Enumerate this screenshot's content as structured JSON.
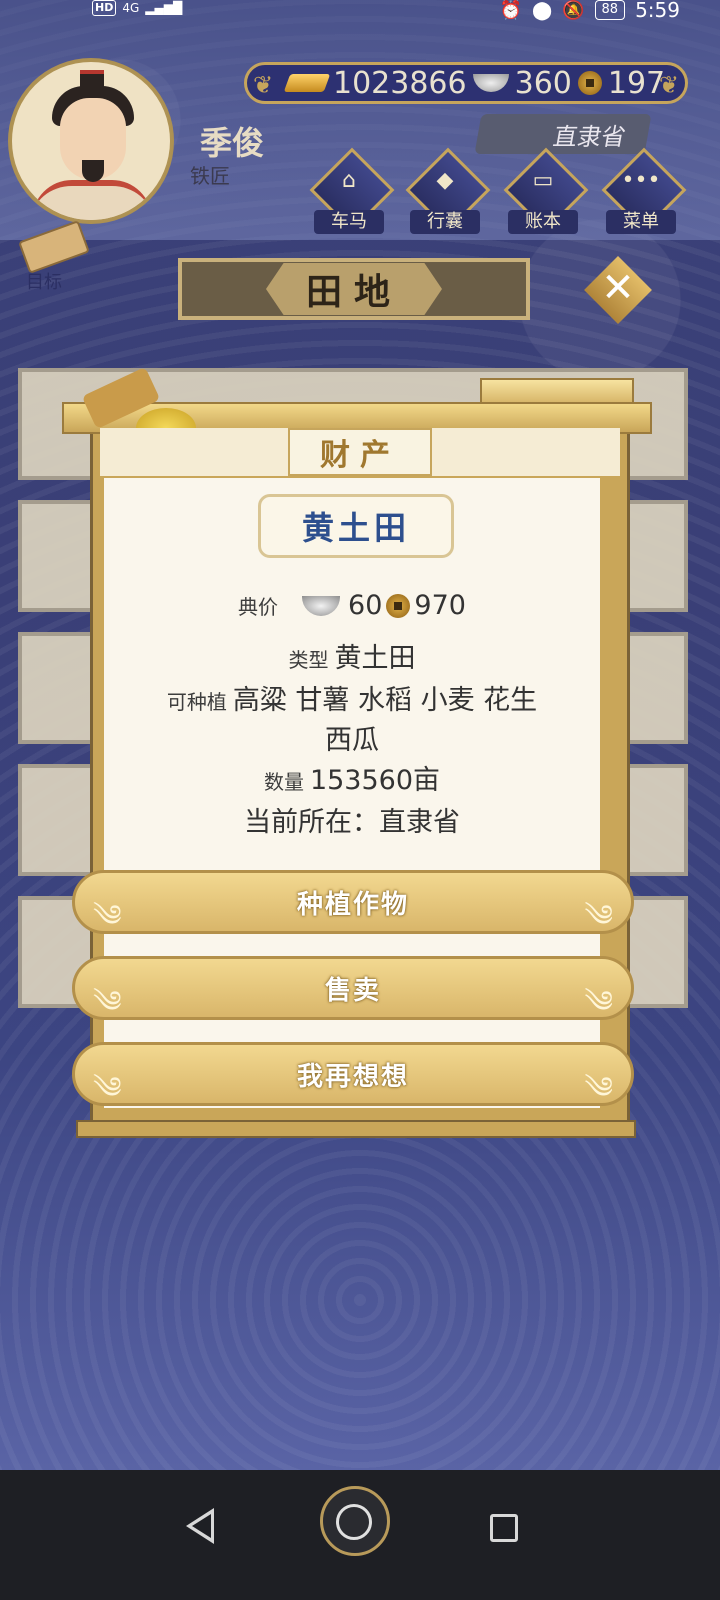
{
  "status_bar": {
    "hd": "HD",
    "network": "4G",
    "battery": "88",
    "time": "5:59"
  },
  "player": {
    "name": "季俊",
    "occupation": "铁匠"
  },
  "currency": {
    "gold": "1023866",
    "silver": "360",
    "copper": "197"
  },
  "location": "直隶省",
  "nav": [
    {
      "label": "车马",
      "icon": "carriage-icon"
    },
    {
      "label": "行囊",
      "icon": "bag-icon"
    },
    {
      "label": "账本",
      "icon": "ledger-icon"
    },
    {
      "label": "菜单",
      "icon": "menu-icon"
    }
  ],
  "target_label": "目标",
  "page_title": "田地",
  "modal": {
    "header": "财产",
    "item_name": "黄土田",
    "price_label": "典价",
    "price_silver": "60",
    "price_copper": "970",
    "type_label": "类型",
    "type_value": "黄土田",
    "plantable_label": "可种植",
    "plantable_line1": "高粱 甘薯 水稻 小麦 花生",
    "plantable_line2": "西瓜",
    "quantity_label": "数量",
    "quantity_value": "153560亩",
    "location_text": "当前所在：直隶省"
  },
  "buttons": {
    "plant": "种植作物",
    "sell": "售卖",
    "cancel": "我再想想"
  },
  "colors": {
    "background": "#3a3f77",
    "gold_accent": "#c9a659",
    "item_name": "#2d4f8e"
  }
}
